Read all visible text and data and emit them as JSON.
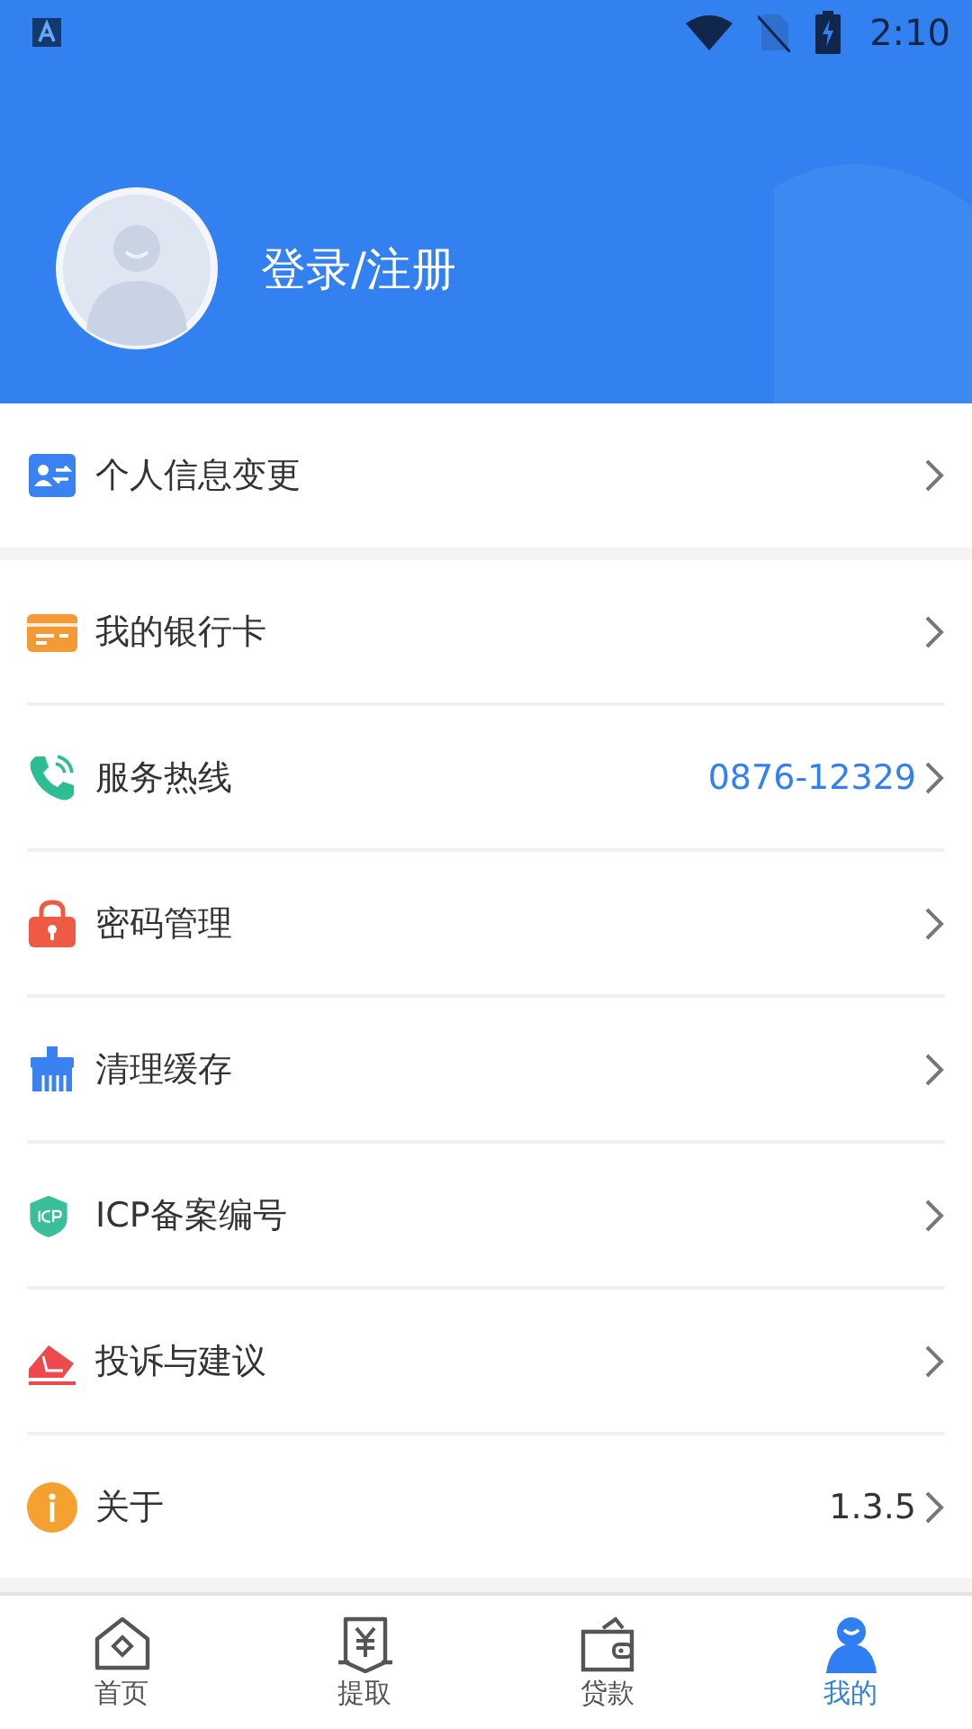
{
  "status_bar": {
    "time": "2:10"
  },
  "profile": {
    "login_label": "登录/注册"
  },
  "menu_groups": [
    [
      {
        "label": "个人信息变更"
      }
    ],
    [
      {
        "label": "我的银行卡"
      },
      {
        "label": "服务热线",
        "value": "0876-12329",
        "kind": "link"
      },
      {
        "label": "密码管理"
      },
      {
        "label": "清理缓存"
      },
      {
        "label": "ICP备案编号"
      },
      {
        "label": "投诉与建议"
      },
      {
        "label": "关于",
        "value": "1.3.5",
        "kind": "plain"
      }
    ]
  ],
  "bottom_nav": [
    {
      "label": "首页",
      "selected": false
    },
    {
      "label": "提取",
      "selected": false
    },
    {
      "label": "贷款",
      "selected": false
    },
    {
      "label": "我的",
      "selected": true
    }
  ]
}
